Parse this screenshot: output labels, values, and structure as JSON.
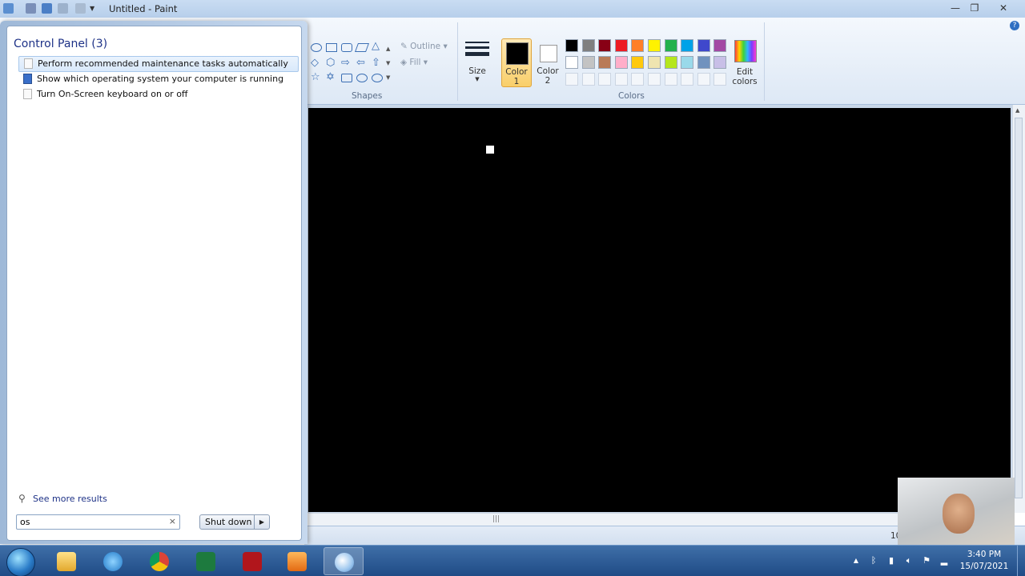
{
  "paint": {
    "window_title": "Untitled - Paint",
    "ribbon": {
      "shapes_group_label": "Shapes",
      "outline_label": "Outline",
      "fill_label": "Fill",
      "size_label": "Size",
      "color1_label": "Color\n1",
      "color2_label": "Color\n2",
      "colors_group_label": "Colors",
      "edit_colors_label": "Edit\ncolors",
      "color1_value": "#000000",
      "color2_value": "#ffffff",
      "palette_row1": [
        "#000000",
        "#7f7f7f",
        "#880015",
        "#ed1c24",
        "#ff7f27",
        "#fff200",
        "#22b14c",
        "#00a2e8",
        "#3f48cc",
        "#a349a4"
      ],
      "palette_row2": [
        "#ffffff",
        "#c3c3c3",
        "#b97a57",
        "#ffaec9",
        "#ffc90e",
        "#efe4b0",
        "#b5e61d",
        "#99d9ea",
        "#7092be",
        "#c8bfe7"
      ]
    },
    "status_zoom_fragment": "10"
  },
  "start_menu": {
    "results_header": "Control Panel (3)",
    "results": [
      {
        "label": "Perform recommended maintenance tasks automatically",
        "selected": true,
        "icon": "task-page-icon"
      },
      {
        "label": "Show which operating system your computer is running",
        "selected": false,
        "icon": "checked-box-icon"
      },
      {
        "label": "Turn On-Screen keyboard on or off",
        "selected": false,
        "icon": "task-page-icon"
      }
    ],
    "see_more": "See more results",
    "search_value": "os",
    "search_clear": "×",
    "shutdown_label": "Shut down",
    "shutdown_arrow": "▶"
  },
  "taskbar": {
    "pinned": [
      "windows-explorer-icon",
      "internet-explorer-icon",
      "chrome-icon",
      "excel-icon",
      "acrobat-icon",
      "media-player-icon",
      "paint-icon"
    ],
    "clock_time": "3:40 PM",
    "clock_date": "15/07/2021"
  }
}
